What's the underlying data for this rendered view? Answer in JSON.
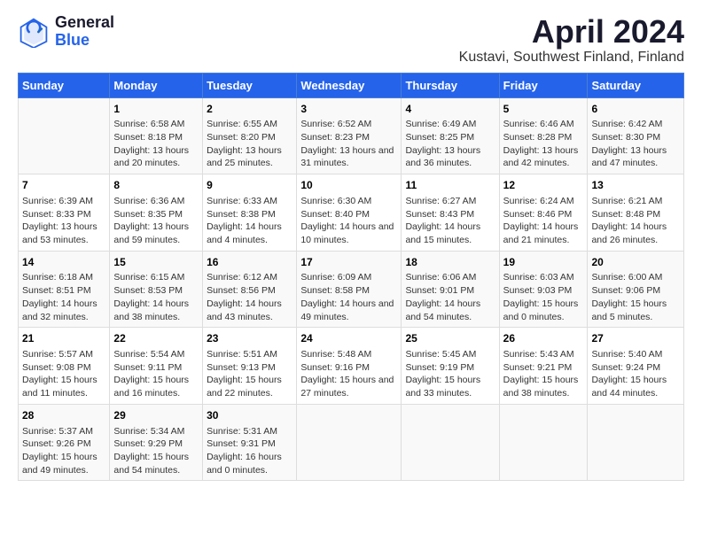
{
  "logo": {
    "general": "General",
    "blue": "Blue"
  },
  "title": "April 2024",
  "subtitle": "Kustavi, Southwest Finland, Finland",
  "days_header": [
    "Sunday",
    "Monday",
    "Tuesday",
    "Wednesday",
    "Thursday",
    "Friday",
    "Saturday"
  ],
  "weeks": [
    [
      {
        "day": "",
        "sunrise": "",
        "sunset": "",
        "daylight": ""
      },
      {
        "day": "1",
        "sunrise": "Sunrise: 6:58 AM",
        "sunset": "Sunset: 8:18 PM",
        "daylight": "Daylight: 13 hours and 20 minutes."
      },
      {
        "day": "2",
        "sunrise": "Sunrise: 6:55 AM",
        "sunset": "Sunset: 8:20 PM",
        "daylight": "Daylight: 13 hours and 25 minutes."
      },
      {
        "day": "3",
        "sunrise": "Sunrise: 6:52 AM",
        "sunset": "Sunset: 8:23 PM",
        "daylight": "Daylight: 13 hours and 31 minutes."
      },
      {
        "day": "4",
        "sunrise": "Sunrise: 6:49 AM",
        "sunset": "Sunset: 8:25 PM",
        "daylight": "Daylight: 13 hours and 36 minutes."
      },
      {
        "day": "5",
        "sunrise": "Sunrise: 6:46 AM",
        "sunset": "Sunset: 8:28 PM",
        "daylight": "Daylight: 13 hours and 42 minutes."
      },
      {
        "day": "6",
        "sunrise": "Sunrise: 6:42 AM",
        "sunset": "Sunset: 8:30 PM",
        "daylight": "Daylight: 13 hours and 47 minutes."
      }
    ],
    [
      {
        "day": "7",
        "sunrise": "Sunrise: 6:39 AM",
        "sunset": "Sunset: 8:33 PM",
        "daylight": "Daylight: 13 hours and 53 minutes."
      },
      {
        "day": "8",
        "sunrise": "Sunrise: 6:36 AM",
        "sunset": "Sunset: 8:35 PM",
        "daylight": "Daylight: 13 hours and 59 minutes."
      },
      {
        "day": "9",
        "sunrise": "Sunrise: 6:33 AM",
        "sunset": "Sunset: 8:38 PM",
        "daylight": "Daylight: 14 hours and 4 minutes."
      },
      {
        "day": "10",
        "sunrise": "Sunrise: 6:30 AM",
        "sunset": "Sunset: 8:40 PM",
        "daylight": "Daylight: 14 hours and 10 minutes."
      },
      {
        "day": "11",
        "sunrise": "Sunrise: 6:27 AM",
        "sunset": "Sunset: 8:43 PM",
        "daylight": "Daylight: 14 hours and 15 minutes."
      },
      {
        "day": "12",
        "sunrise": "Sunrise: 6:24 AM",
        "sunset": "Sunset: 8:46 PM",
        "daylight": "Daylight: 14 hours and 21 minutes."
      },
      {
        "day": "13",
        "sunrise": "Sunrise: 6:21 AM",
        "sunset": "Sunset: 8:48 PM",
        "daylight": "Daylight: 14 hours and 26 minutes."
      }
    ],
    [
      {
        "day": "14",
        "sunrise": "Sunrise: 6:18 AM",
        "sunset": "Sunset: 8:51 PM",
        "daylight": "Daylight: 14 hours and 32 minutes."
      },
      {
        "day": "15",
        "sunrise": "Sunrise: 6:15 AM",
        "sunset": "Sunset: 8:53 PM",
        "daylight": "Daylight: 14 hours and 38 minutes."
      },
      {
        "day": "16",
        "sunrise": "Sunrise: 6:12 AM",
        "sunset": "Sunset: 8:56 PM",
        "daylight": "Daylight: 14 hours and 43 minutes."
      },
      {
        "day": "17",
        "sunrise": "Sunrise: 6:09 AM",
        "sunset": "Sunset: 8:58 PM",
        "daylight": "Daylight: 14 hours and 49 minutes."
      },
      {
        "day": "18",
        "sunrise": "Sunrise: 6:06 AM",
        "sunset": "Sunset: 9:01 PM",
        "daylight": "Daylight: 14 hours and 54 minutes."
      },
      {
        "day": "19",
        "sunrise": "Sunrise: 6:03 AM",
        "sunset": "Sunset: 9:03 PM",
        "daylight": "Daylight: 15 hours and 0 minutes."
      },
      {
        "day": "20",
        "sunrise": "Sunrise: 6:00 AM",
        "sunset": "Sunset: 9:06 PM",
        "daylight": "Daylight: 15 hours and 5 minutes."
      }
    ],
    [
      {
        "day": "21",
        "sunrise": "Sunrise: 5:57 AM",
        "sunset": "Sunset: 9:08 PM",
        "daylight": "Daylight: 15 hours and 11 minutes."
      },
      {
        "day": "22",
        "sunrise": "Sunrise: 5:54 AM",
        "sunset": "Sunset: 9:11 PM",
        "daylight": "Daylight: 15 hours and 16 minutes."
      },
      {
        "day": "23",
        "sunrise": "Sunrise: 5:51 AM",
        "sunset": "Sunset: 9:13 PM",
        "daylight": "Daylight: 15 hours and 22 minutes."
      },
      {
        "day": "24",
        "sunrise": "Sunrise: 5:48 AM",
        "sunset": "Sunset: 9:16 PM",
        "daylight": "Daylight: 15 hours and 27 minutes."
      },
      {
        "day": "25",
        "sunrise": "Sunrise: 5:45 AM",
        "sunset": "Sunset: 9:19 PM",
        "daylight": "Daylight: 15 hours and 33 minutes."
      },
      {
        "day": "26",
        "sunrise": "Sunrise: 5:43 AM",
        "sunset": "Sunset: 9:21 PM",
        "daylight": "Daylight: 15 hours and 38 minutes."
      },
      {
        "day": "27",
        "sunrise": "Sunrise: 5:40 AM",
        "sunset": "Sunset: 9:24 PM",
        "daylight": "Daylight: 15 hours and 44 minutes."
      }
    ],
    [
      {
        "day": "28",
        "sunrise": "Sunrise: 5:37 AM",
        "sunset": "Sunset: 9:26 PM",
        "daylight": "Daylight: 15 hours and 49 minutes."
      },
      {
        "day": "29",
        "sunrise": "Sunrise: 5:34 AM",
        "sunset": "Sunset: 9:29 PM",
        "daylight": "Daylight: 15 hours and 54 minutes."
      },
      {
        "day": "30",
        "sunrise": "Sunrise: 5:31 AM",
        "sunset": "Sunset: 9:31 PM",
        "daylight": "Daylight: 16 hours and 0 minutes."
      },
      {
        "day": "",
        "sunrise": "",
        "sunset": "",
        "daylight": ""
      },
      {
        "day": "",
        "sunrise": "",
        "sunset": "",
        "daylight": ""
      },
      {
        "day": "",
        "sunrise": "",
        "sunset": "",
        "daylight": ""
      },
      {
        "day": "",
        "sunrise": "",
        "sunset": "",
        "daylight": ""
      }
    ]
  ]
}
